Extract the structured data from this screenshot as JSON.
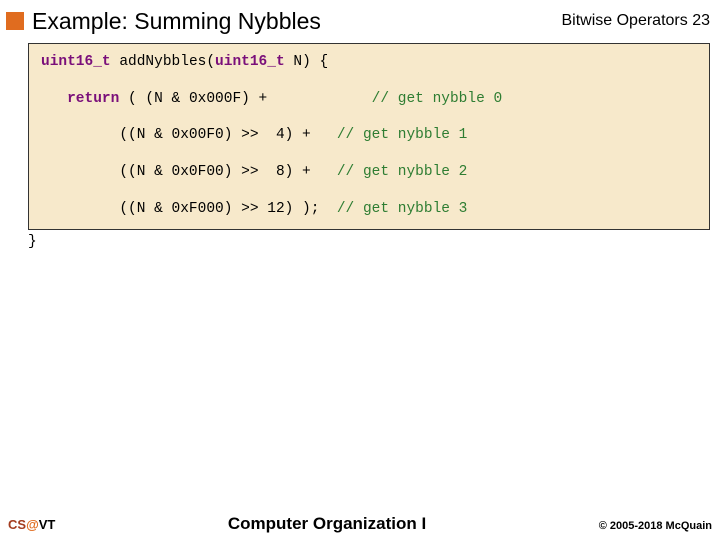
{
  "header": {
    "title": "Example: Summing Nybbles",
    "chapter": "Bitwise Operators",
    "pagenum": "23"
  },
  "code": {
    "kw_type": "uint16_t",
    "fn_decl_a": " addNybbles(",
    "fn_decl_b": " N) {",
    "kw_return": "return",
    "l0_code": " ( (N & 0x000F) +            ",
    "l0_cmt": "// get nybble 0",
    "l1_code": "         ((N & 0x00F0) >>  4) +   ",
    "l1_cmt": "// get nybble 1",
    "l2_code": "         ((N & 0x0F00) >>  8) +   ",
    "l2_cmt": "// get nybble 2",
    "l3_code": "         ((N & 0xF000) >> 12) );  ",
    "l3_cmt": "// get nybble 3",
    "close": "}"
  },
  "footer": {
    "cs": "CS",
    "at": "@",
    "vt": "VT",
    "course": "Computer Organization I",
    "copyright": "© 2005-2018 McQuain"
  }
}
